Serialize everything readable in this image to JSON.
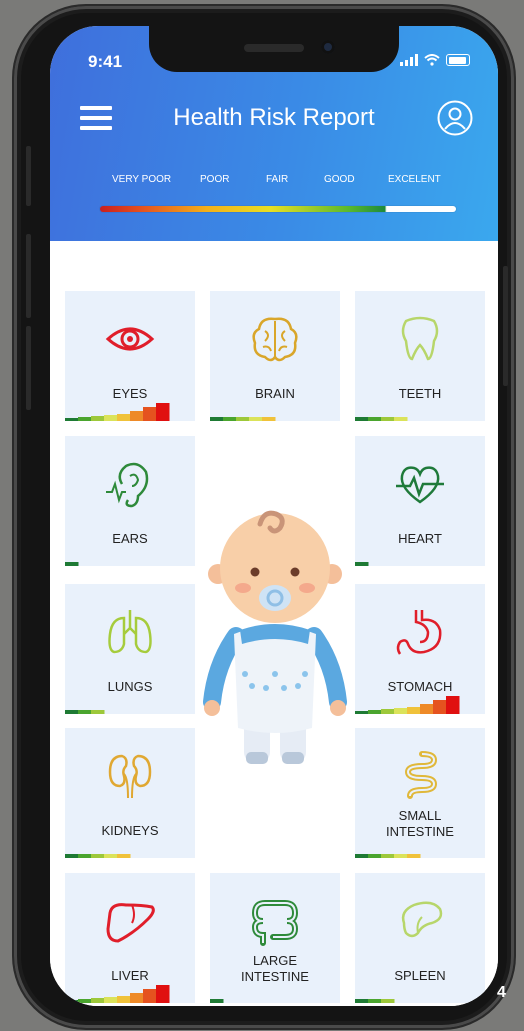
{
  "status_bar": {
    "time": "9:41"
  },
  "header": {
    "title": "Health Risk Report"
  },
  "scale": {
    "labels": [
      "VERY POOR",
      "POOR",
      "FAIR",
      "GOOD",
      "EXCELENT"
    ]
  },
  "colors": {
    "header_start": "#3f6fdc",
    "header_end": "#3aa8ee",
    "tile_bg": "#e9f1fb",
    "level_1": "#1e7a34",
    "level_2": "#4aa52e",
    "level_3": "#9dc83a",
    "level_4": "#dbe35a",
    "level_5": "#f0c23a",
    "level_6": "#ee8a28",
    "level_7": "#e5531f",
    "level_8": "#e01010"
  },
  "organs": [
    {
      "id": "eyes",
      "label_lines": [
        "EYES"
      ],
      "icon": "eye-icon",
      "icon_color": "#e01e2a",
      "risk_level": 8
    },
    {
      "id": "brain",
      "label_lines": [
        "BRAIN"
      ],
      "icon": "brain-icon",
      "icon_color": "#d9a62a",
      "risk_level": 5
    },
    {
      "id": "teeth",
      "label_lines": [
        "TEETH"
      ],
      "icon": "tooth-icon",
      "icon_color": "#b7d66a",
      "risk_level": 4
    },
    {
      "id": "ears",
      "label_lines": [
        "EARS"
      ],
      "icon": "ear-icon",
      "icon_color": "#2e8a3a",
      "risk_level": 1
    },
    {
      "id": "heart",
      "label_lines": [
        "HEART"
      ],
      "icon": "heart-pulse-icon",
      "icon_color": "#1f7a3a",
      "risk_level": 1
    },
    {
      "id": "lungs",
      "label_lines": [
        "LUNGS"
      ],
      "icon": "lungs-icon",
      "icon_color": "#a6cc3c",
      "risk_level": 3
    },
    {
      "id": "stomach",
      "label_lines": [
        "STOMACH"
      ],
      "icon": "stomach-icon",
      "icon_color": "#e01e2a",
      "risk_level": 8
    },
    {
      "id": "kidneys",
      "label_lines": [
        "KIDNEYS"
      ],
      "icon": "kidneys-icon",
      "icon_color": "#e0a832",
      "risk_level": 5
    },
    {
      "id": "small-intestine",
      "label_lines": [
        "SMALL",
        "INTESTINE"
      ],
      "icon": "small-intestine-icon",
      "icon_color": "#e0b83a",
      "risk_level": 5
    },
    {
      "id": "liver",
      "label_lines": [
        "LIVER"
      ],
      "icon": "liver-icon",
      "icon_color": "#e01e2a",
      "risk_level": 8
    },
    {
      "id": "large-intestine",
      "label_lines": [
        "LARGE",
        "INTESTINE"
      ],
      "icon": "large-intestine-icon",
      "icon_color": "#2e8a3a",
      "risk_level": 1
    },
    {
      "id": "spleen",
      "label_lines": [
        "SPLEEN"
      ],
      "icon": "spleen-icon",
      "icon_color": "#b7d66a",
      "risk_level": 3
    }
  ],
  "page_number": "4"
}
